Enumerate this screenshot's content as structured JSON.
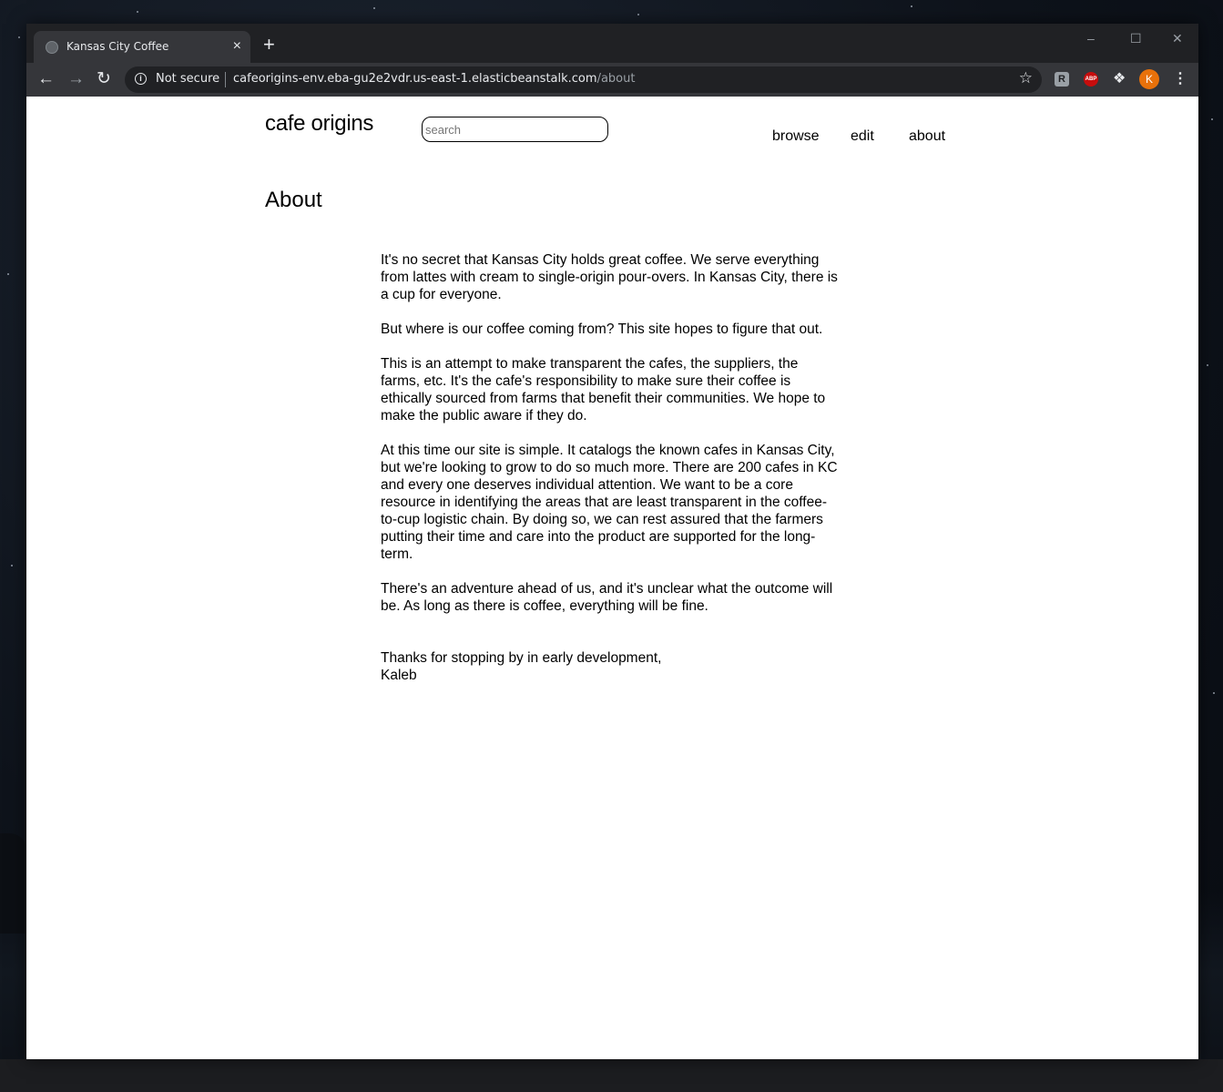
{
  "browser": {
    "tab_title": "Kansas City Coffee",
    "tab_close": "×",
    "new_tab": "+",
    "security_label": "Not secure",
    "url_host": "cafeorigins-env.eba-gu2e2vdr.us-east-1.elasticbeanstalk.com",
    "url_path": "/about",
    "profile_initial": "K",
    "abp_label": "ABP"
  },
  "site": {
    "brand": "cafe origins",
    "search_placeholder": "search",
    "nav": {
      "browse": "browse",
      "edit": "edit",
      "about": "about"
    }
  },
  "page": {
    "heading": "About",
    "paragraphs": [
      "It's no secret that Kansas City holds great coffee. We serve everything from lattes with cream to single-origin pour-overs. In Kansas City, there is a cup for everyone.",
      "But where is our coffee coming from? This site hopes to figure that out.",
      "This is an attempt to make transparent the cafes, the suppliers, the farms, etc. It's the cafe's responsibility to make sure their coffee is ethically sourced from farms that benefit their communities. We hope to make the public aware if they do.",
      "At this time our site is simple. It catalogs the known cafes in Kansas City, but we're looking to grow to do so much more. There are 200 cafes in KC and every one deserves individual attention. We want to be a core resource in identifying the areas that are least transparent in the coffee-to-cup logistic chain. By doing so, we can rest assured that the farmers putting their time and care into the product are supported for the long-term.",
      "There's an adventure ahead of us, and it's unclear what the outcome will be. As long as there is coffee, everything will be fine."
    ],
    "signoff_line1": "Thanks for stopping by in early development,",
    "signoff_line2": "Kaleb"
  }
}
